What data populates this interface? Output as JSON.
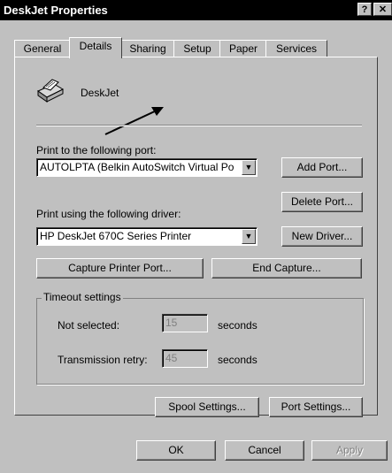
{
  "window": {
    "title": "DeskJet Properties",
    "help_btn": "?",
    "close_btn": "✕"
  },
  "tabs": [
    {
      "label": "General"
    },
    {
      "label": "Details"
    },
    {
      "label": "Sharing"
    },
    {
      "label": "Setup"
    },
    {
      "label": "Paper"
    },
    {
      "label": "Services"
    }
  ],
  "printer": {
    "name": "DeskJet",
    "icon": "printer-icon"
  },
  "port": {
    "label": "Print to the following port:",
    "value": "AUTOLPTA  (Belkin AutoSwitch Virtual Po",
    "add_button": "Add Port...",
    "delete_button": "Delete Port..."
  },
  "driver": {
    "label": "Print using the following driver:",
    "value": "HP DeskJet 670C Series Printer",
    "new_button": "New Driver..."
  },
  "capture": {
    "capture_button": "Capture Printer Port...",
    "end_button": "End Capture..."
  },
  "timeout": {
    "title": "Timeout settings",
    "not_selected_label": "Not selected:",
    "not_selected_value": "15",
    "transmission_label": "Transmission retry:",
    "transmission_value": "45",
    "units": "seconds"
  },
  "spool_button": "Spool Settings...",
  "port_settings_button": "Port Settings...",
  "footer": {
    "ok": "OK",
    "cancel": "Cancel",
    "apply": "Apply"
  }
}
